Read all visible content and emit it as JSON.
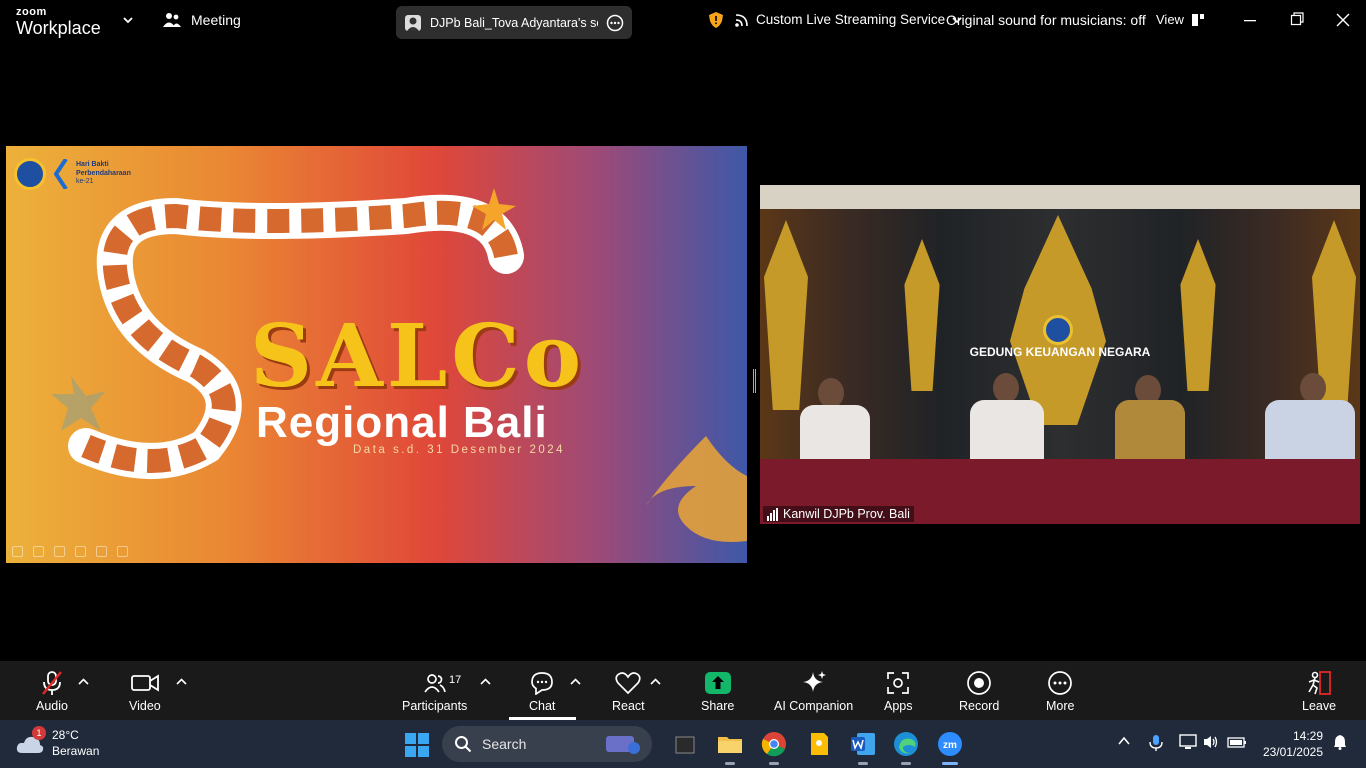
{
  "app": {
    "logo_line1": "zoom",
    "logo_line2": "Workplace",
    "meeting_label": "Meeting",
    "share_title": "DJPb Bali_Tova Adyantara's scree",
    "stream_label": "Custom Live Streaming Service",
    "original_sound": "Original sound for musicians: off",
    "view_label": "View"
  },
  "slide": {
    "corner_line1": "Hari Bakti",
    "corner_line2": "Perbendaharaan",
    "corner_line3": "ke-21",
    "title_main": "SALCo",
    "title_sub": "Regional Bali",
    "date_line": "Data s.d. 31 Desember 2024"
  },
  "video": {
    "backdrop_text": "GEDUNG KEUANGAN NEGARA",
    "participant_name": "Kanwil DJPb Prov. Bali"
  },
  "toolbar": {
    "audio": "Audio",
    "video": "Video",
    "participants": "Participants",
    "participants_count": "17",
    "chat": "Chat",
    "react": "React",
    "share": "Share",
    "ai_companion": "AI Companion",
    "apps": "Apps",
    "record": "Record",
    "more": "More",
    "leave": "Leave"
  },
  "taskbar": {
    "weather_badge": "1",
    "temperature": "28°C",
    "condition": "Berawan",
    "search_placeholder": "Search",
    "time": "14:29",
    "date": "23/01/2025"
  },
  "colors": {
    "toolbar_bg": "#1a1a1a",
    "taskbar_bg": "#202a3b",
    "share_green": "#12b76a",
    "mute_red": "#e02828",
    "leave_red": "#e02828",
    "salco_yellow": "#f5c31a"
  },
  "icons": {
    "mute": "microphone-muted-icon",
    "video": "video-camera-icon",
    "participants": "people-icon",
    "chat": "chat-bubble-icon",
    "react": "heart-icon",
    "share": "share-arrow-icon",
    "ai": "sparkle-icon",
    "apps": "apps-grid-icon",
    "record": "record-icon",
    "more": "more-dots-icon",
    "leave": "leave-person-icon"
  }
}
